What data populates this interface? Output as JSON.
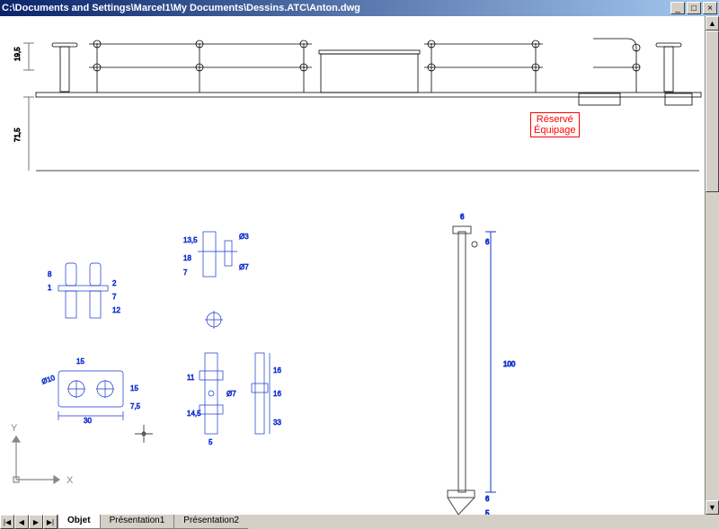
{
  "title_path": "C:\\Documents and Settings\\Marcel1\\My Documents\\Dessins.ATC\\Anton.dwg",
  "window_buttons": {
    "minimize": "_",
    "maximize": "□",
    "close": "×"
  },
  "tabs": [
    {
      "label": "Objet",
      "active": true
    },
    {
      "label": "Présentation1",
      "active": false
    },
    {
      "label": "Présentation2",
      "active": false
    }
  ],
  "nav": {
    "first": "|◀",
    "prev": "◀",
    "next": "▶",
    "last": "▶|"
  },
  "scroll": {
    "up": "▲",
    "down": "▼"
  },
  "ucs": {
    "x": "X",
    "y": "Y"
  },
  "reserved_label": {
    "line1": "Réservé",
    "line2": "Équipage"
  },
  "dimensions": {
    "h1": "19,5",
    "h2": "71,5",
    "d_col": {
      "a": "8",
      "b": "1",
      "c": "7",
      "d": "12",
      "e": "2"
    },
    "d_plate": {
      "dia": "Ø10",
      "w": "15",
      "W": "30",
      "h": "15",
      "s": "7,5"
    },
    "d_mid": {
      "a": "13,5",
      "b": "18",
      "c": "7",
      "d": "Ø3",
      "e": "Ø7"
    },
    "d_mid2": {
      "a": "11",
      "b": "14,5",
      "c": "5",
      "d": "Ø7"
    },
    "d_right": {
      "a": "16",
      "b": "16",
      "c": "33"
    },
    "d_post": {
      "top1": "6",
      "top2": "6",
      "len": "100",
      "bot1": "6",
      "bot2": "5"
    }
  }
}
